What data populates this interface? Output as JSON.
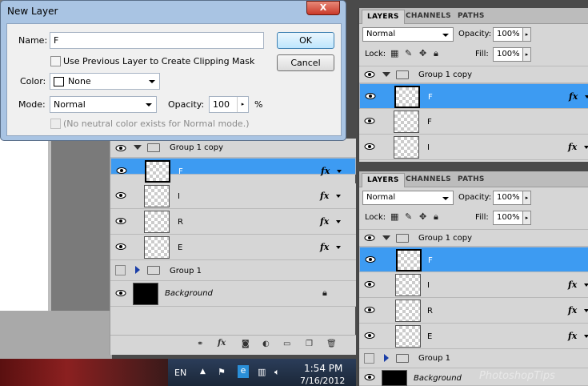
{
  "dialog": {
    "title": "New Layer",
    "close_label": "X",
    "name_label": "Name:",
    "name_value": "F",
    "clip_label": "Use Previous Layer to Create Clipping Mask",
    "color_label": "Color:",
    "color_value": "None",
    "mode_label": "Mode:",
    "mode_value": "Normal",
    "opacity_label": "Opacity:",
    "opacity_value": "100",
    "opacity_unit": "%",
    "neutral_label": "(No neutral color exists for Normal mode.)",
    "ok_label": "OK",
    "cancel_label": "Cancel"
  },
  "left_panel": {
    "rows": [
      {
        "name": "Group 1 copy",
        "kind": "group-open"
      },
      {
        "name": "F",
        "kind": "layer",
        "selected": true,
        "fx": "fx"
      },
      {
        "name": "I",
        "kind": "layer",
        "fx": "fx"
      },
      {
        "name": "R",
        "kind": "layer",
        "fx": "fx"
      },
      {
        "name": "E",
        "kind": "layer",
        "fx": "fx"
      },
      {
        "name": "Group 1",
        "kind": "group-closed"
      },
      {
        "name": "Background",
        "kind": "background"
      }
    ],
    "footer_icons": [
      "link-icon",
      "fx-icon",
      "mask-icon",
      "adjustment-icon",
      "folder-icon",
      "new-layer-icon",
      "trash-icon"
    ],
    "footer_fx": "fx"
  },
  "right_top": {
    "tabs": [
      "LAYERS",
      "CHANNELS",
      "PATHS"
    ],
    "blend_mode": "Normal",
    "opacity_label": "Opacity:",
    "opacity_value": "100%",
    "lock_label": "Lock:",
    "fill_label": "Fill:",
    "fill_value": "100%",
    "rows": [
      {
        "name": "Group 1 copy",
        "kind": "group-open"
      },
      {
        "name": "F",
        "kind": "layer",
        "selected": true,
        "fx": "fx"
      },
      {
        "name": "F",
        "kind": "layer"
      },
      {
        "name": "I",
        "kind": "layer",
        "fx": "fx"
      }
    ]
  },
  "right_bottom": {
    "tabs": [
      "LAYERS",
      "CHANNELS",
      "PATHS"
    ],
    "blend_mode": "Normal",
    "opacity_label": "Opacity:",
    "opacity_value": "100%",
    "lock_label": "Lock:",
    "fill_label": "Fill:",
    "fill_value": "100%",
    "rows": [
      {
        "name": "Group 1 copy",
        "kind": "group-open"
      },
      {
        "name": "F",
        "kind": "layer",
        "selected": true
      },
      {
        "name": "I",
        "kind": "layer",
        "fx": "fx"
      },
      {
        "name": "R",
        "kind": "layer",
        "fx": "fx"
      },
      {
        "name": "E",
        "kind": "layer",
        "fx": "fx"
      },
      {
        "name": "Group 1",
        "kind": "group-closed"
      },
      {
        "name": "Background",
        "kind": "background"
      }
    ],
    "watermark": "PhotoshopTips"
  },
  "taskbar": {
    "lang": "EN",
    "time": "1:54 PM",
    "date": "7/16/2012"
  },
  "colors": {
    "selection": "#3d9bf2",
    "panel_bg": "#d6d6d6",
    "dialog_frame": "#a9c4e3"
  }
}
